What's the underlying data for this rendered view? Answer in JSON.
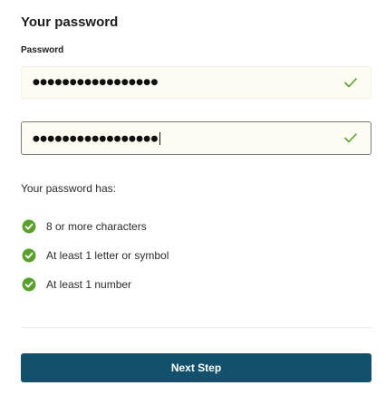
{
  "heading": "Your password",
  "password_field": {
    "label": "Password",
    "value_masked": "●●●●●●●●●●●●●●●●●",
    "status_icon": "check-icon"
  },
  "confirm_field": {
    "value_masked": "●●●●●●●●●●●●●●●●●",
    "status_icon": "check-icon"
  },
  "requirements": {
    "intro": "Your password has:",
    "items": [
      {
        "label": "8 or more characters",
        "met": true,
        "icon": "check-circle-icon"
      },
      {
        "label": "At least 1 letter or symbol",
        "met": true,
        "icon": "check-circle-icon"
      },
      {
        "label": "At least 1 number",
        "met": true,
        "icon": "check-circle-icon"
      }
    ]
  },
  "actions": {
    "next_label": "Next Step"
  },
  "colors": {
    "primary": "#12506b",
    "success": "#5aa02c",
    "field_bg": "#fcfcf2"
  }
}
